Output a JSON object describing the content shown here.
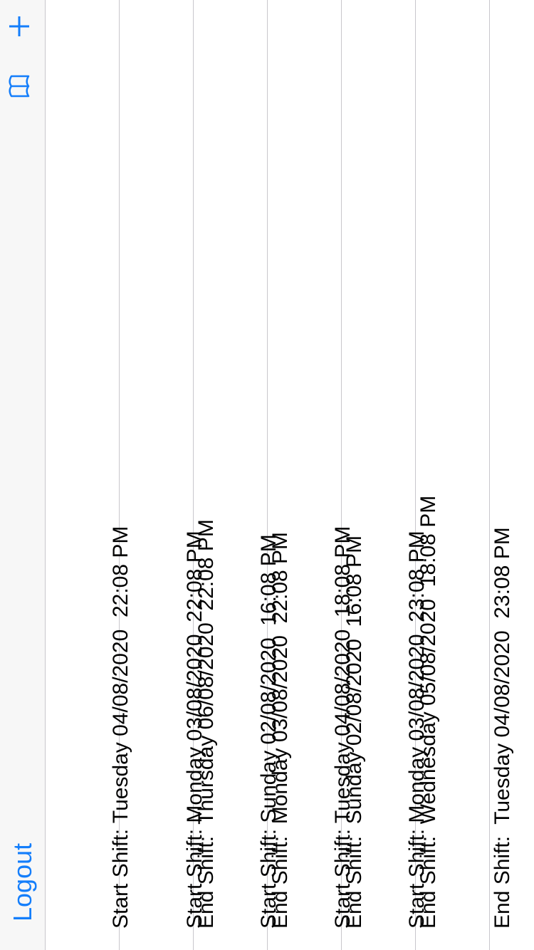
{
  "navbar": {
    "left_label": "Logout",
    "right_icons": [
      "book-icon",
      "plus-icon"
    ],
    "accent_color": "#147efb"
  },
  "shifts": [
    {
      "start_label": "Start Shift:",
      "start_value": "Tuesday 04/08/2020  22:08 PM",
      "end_label": "End Shift:",
      "end_value": "Thursday 06/08/2020  22:08 PM"
    },
    {
      "start_label": "Start Shift:",
      "start_value": "Monday 03/08/2020  22:08 PM",
      "end_label": "End Shift:",
      "end_value": "Monday 03/08/2020  22:08 PM"
    },
    {
      "start_label": "Start Shift:",
      "start_value": "Sunday 02/08/2020  16:08 PM",
      "end_label": "End Shift:",
      "end_value": "Sunday 02/08/2020  16:08 PM"
    },
    {
      "start_label": "Start Shift:",
      "start_value": "Tuesday 04/08/2020  18:08 PM",
      "end_label": "End Shift:",
      "end_value": "Wednesday 05/08/2020  18:08 PM"
    },
    {
      "start_label": "Start Shift:",
      "start_value": "Monday 03/08/2020  23:08 PM",
      "end_label": "End Shift:",
      "end_value": "Tuesday 04/08/2020  23:08 PM"
    }
  ]
}
